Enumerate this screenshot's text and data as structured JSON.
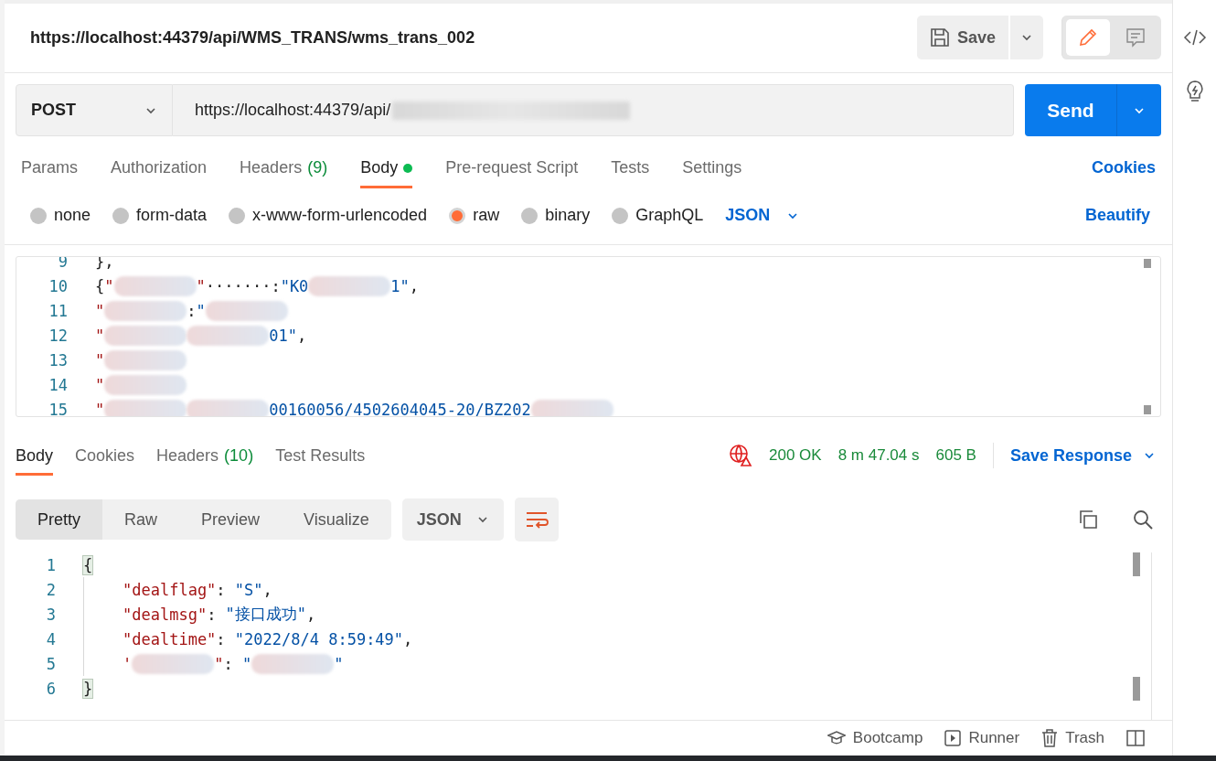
{
  "request_title": "https://localhost:44379/api/WMS_TRANS/wms_trans_002",
  "save_button": "Save",
  "method": "POST",
  "url": "https://localhost:44379/api/",
  "send_button": "Send",
  "request_tabs": [
    {
      "label": "Params",
      "selected": false
    },
    {
      "label": "Authorization",
      "selected": false
    },
    {
      "label": "Headers",
      "count": "(9)",
      "selected": false
    },
    {
      "label": "Body",
      "selected": true,
      "dot": true
    },
    {
      "label": "Pre-request Script",
      "selected": false
    },
    {
      "label": "Tests",
      "selected": false
    },
    {
      "label": "Settings",
      "selected": false
    }
  ],
  "cookies_link": "Cookies",
  "body_types": [
    {
      "label": "none",
      "selected": false
    },
    {
      "label": "form-data",
      "selected": false
    },
    {
      "label": "x-www-form-urlencoded",
      "selected": false
    },
    {
      "label": "raw",
      "selected": true
    },
    {
      "label": "binary",
      "selected": false
    },
    {
      "label": "GraphQL",
      "selected": false
    }
  ],
  "body_format": "JSON",
  "beautify_link": "Beautify",
  "request_body": [
    {
      "number": "9",
      "parts": [
        {
          "kind": "punct",
          "text": "},"
        }
      ]
    },
    {
      "number": "10",
      "parts": [
        {
          "kind": "punct",
          "text": "{"
        },
        {
          "kind": "key",
          "text": "\""
        },
        {
          "kind": "blur"
        },
        {
          "kind": "key",
          "text": "\""
        },
        {
          "kind": "punct",
          "text": "·······:"
        },
        {
          "kind": "str",
          "text": "\"K0"
        },
        {
          "kind": "blur"
        },
        {
          "kind": "str",
          "text": "1\""
        },
        {
          "kind": "punct",
          "text": ","
        }
      ]
    },
    {
      "number": "11",
      "parts": [
        {
          "kind": "key",
          "text": "\""
        },
        {
          "kind": "blur"
        },
        {
          "kind": "punct",
          "text": ":"
        },
        {
          "kind": "str",
          "text": "\""
        },
        {
          "kind": "blur"
        }
      ]
    },
    {
      "number": "12",
      "parts": [
        {
          "kind": "key",
          "text": "\""
        },
        {
          "kind": "blur"
        },
        {
          "kind": "blur"
        },
        {
          "kind": "str",
          "text": "01\""
        },
        {
          "kind": "punct",
          "text": ","
        }
      ]
    },
    {
      "number": "13",
      "parts": [
        {
          "kind": "key",
          "text": "\""
        },
        {
          "kind": "blur"
        }
      ]
    },
    {
      "number": "14",
      "parts": [
        {
          "kind": "key",
          "text": "\""
        },
        {
          "kind": "blur"
        }
      ]
    },
    {
      "number": "15",
      "parts": [
        {
          "kind": "key",
          "text": "\""
        },
        {
          "kind": "blur"
        },
        {
          "kind": "blur"
        },
        {
          "kind": "str",
          "text": "00160056/4502604045-20/BZ202"
        },
        {
          "kind": "blur"
        }
      ]
    }
  ],
  "response_tabs": [
    {
      "label": "Body",
      "selected": true
    },
    {
      "label": "Cookies",
      "selected": false
    },
    {
      "label": "Headers",
      "count": "(10)",
      "selected": false
    },
    {
      "label": "Test Results",
      "selected": false
    }
  ],
  "response_status": {
    "code": "200 OK",
    "time": "8 m 47.04 s",
    "size": "605 B"
  },
  "save_response": "Save Response",
  "view_modes": [
    {
      "label": "Pretty",
      "selected": true
    },
    {
      "label": "Raw",
      "selected": false
    },
    {
      "label": "Preview",
      "selected": false
    },
    {
      "label": "Visualize",
      "selected": false
    }
  ],
  "response_format": "JSON",
  "response_body": [
    {
      "number": "1",
      "parts": [
        {
          "kind": "brace",
          "text": "{"
        }
      ]
    },
    {
      "number": "2",
      "parts": [
        {
          "kind": "indent"
        },
        {
          "kind": "key",
          "text": "\"dealflag\""
        },
        {
          "kind": "punct",
          "text": ": "
        },
        {
          "kind": "str",
          "text": "\"S\""
        },
        {
          "kind": "punct",
          "text": ","
        }
      ]
    },
    {
      "number": "3",
      "parts": [
        {
          "kind": "indent"
        },
        {
          "kind": "key",
          "text": "\"dealmsg\""
        },
        {
          "kind": "punct",
          "text": ": "
        },
        {
          "kind": "str",
          "text": "\"接口成功\""
        },
        {
          "kind": "punct",
          "text": ","
        }
      ]
    },
    {
      "number": "4",
      "parts": [
        {
          "kind": "indent"
        },
        {
          "kind": "key",
          "text": "\"dealtime\""
        },
        {
          "kind": "punct",
          "text": ": "
        },
        {
          "kind": "str",
          "text": "\"2022/8/4 8:59:49\""
        },
        {
          "kind": "punct",
          "text": ","
        }
      ]
    },
    {
      "number": "5",
      "parts": [
        {
          "kind": "indent"
        },
        {
          "kind": "key",
          "text": "'"
        },
        {
          "kind": "blur"
        },
        {
          "kind": "key",
          "text": "\""
        },
        {
          "kind": "punct",
          "text": ": "
        },
        {
          "kind": "str",
          "text": "\""
        },
        {
          "kind": "blur"
        },
        {
          "kind": "str",
          "text": "\""
        }
      ]
    },
    {
      "number": "6",
      "parts": [
        {
          "kind": "brace",
          "text": "}"
        }
      ]
    }
  ],
  "footer": [
    "Bootcamp",
    "Runner",
    "Trash"
  ]
}
